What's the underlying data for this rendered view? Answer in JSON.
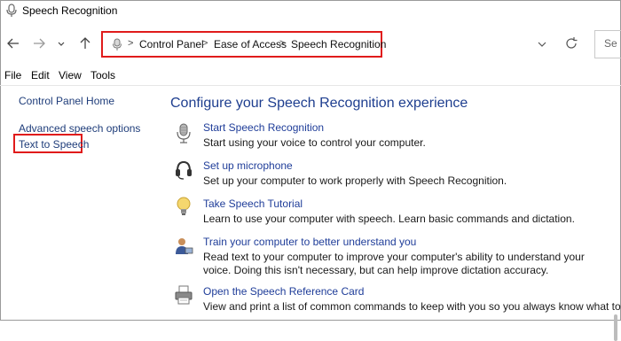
{
  "window": {
    "title": "Speech Recognition",
    "icon": "microphone-icon"
  },
  "nav": {
    "back_icon": "arrow-left-icon",
    "forward_icon": "arrow-right-icon",
    "recent_icon": "chevron-down-icon",
    "up_icon": "arrow-up-icon",
    "breadcrumb": [
      "Control Panel",
      "Ease of Access",
      "Speech Recognition"
    ],
    "refresh_icon": "refresh-icon",
    "search_placeholder": "Se"
  },
  "menu": [
    "File",
    "Edit",
    "View",
    "Tools"
  ],
  "sidebar": {
    "home": "Control Panel Home",
    "links": [
      "Advanced speech options",
      "Text to Speech"
    ]
  },
  "main": {
    "heading": "Configure your Speech Recognition experience",
    "tasks": [
      {
        "title": "Start Speech Recognition",
        "desc": "Start using your voice to control your computer.",
        "icon": "microphone-icon"
      },
      {
        "title": "Set up microphone",
        "desc": "Set up your computer to work properly with Speech Recognition.",
        "icon": "headset-icon"
      },
      {
        "title": "Take Speech Tutorial",
        "desc": "Learn to use your computer with speech.  Learn basic commands and dictation.",
        "icon": "lightbulb-icon"
      },
      {
        "title": "Train your computer to better understand you",
        "desc": "Read text to your computer to improve your computer's ability to understand your voice.  Doing this isn't necessary, but can help improve dictation accuracy.",
        "icon": "user-training-icon"
      },
      {
        "title": "Open the Speech Reference Card",
        "desc": "View and print a list of common commands to keep with you so you always know what to say.",
        "icon": "printer-icon"
      }
    ]
  },
  "colors": {
    "highlight": "#e01b1b",
    "link": "#1f3d99",
    "heading": "#1e3e8f"
  }
}
